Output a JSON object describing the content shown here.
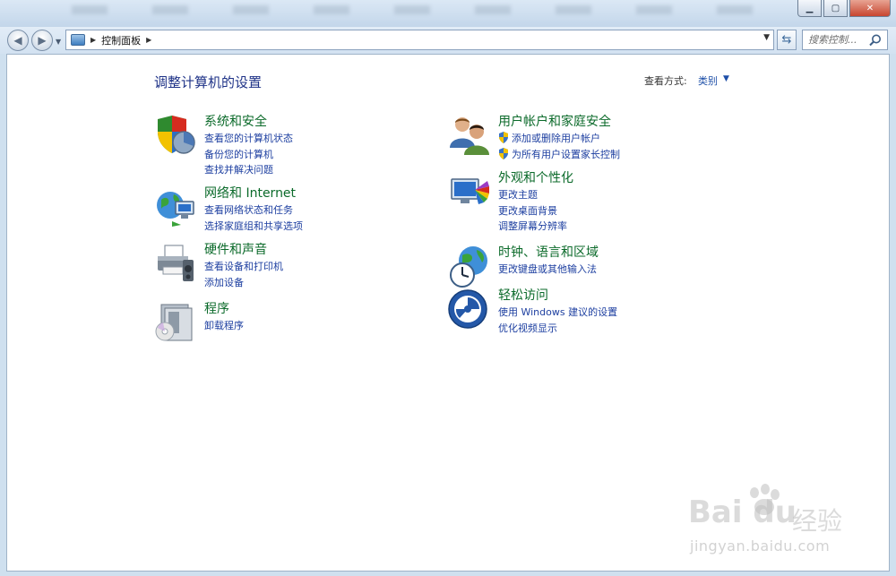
{
  "address": {
    "location": "控制面板"
  },
  "search": {
    "placeholder": "搜索控制..."
  },
  "view": {
    "label": "查看方式:",
    "value": "类别"
  },
  "page": {
    "title": "调整计算机的设置"
  },
  "categories": [
    {
      "title": "系统和安全",
      "icon": "shield-pie-icon",
      "links": [
        "查看您的计算机状态",
        "备份您的计算机",
        "查找并解决问题"
      ]
    },
    {
      "title": "网络和 Internet",
      "icon": "globe-network-icon",
      "links": [
        "查看网络状态和任务",
        "选择家庭组和共享选项"
      ]
    },
    {
      "title": "硬件和声音",
      "icon": "printer-icon",
      "links": [
        "查看设备和打印机",
        "添加设备"
      ]
    },
    {
      "title": "程序",
      "icon": "programs-icon",
      "links": [
        "卸载程序"
      ]
    },
    {
      "title": "用户帐户和家庭安全",
      "icon": "users-icon",
      "links": [
        "添加或删除用户帐户",
        "为所有用户设置家长控制"
      ]
    },
    {
      "title": "外观和个性化",
      "icon": "monitor-palette-icon",
      "links": [
        "更改主题",
        "更改桌面背景",
        "调整屏幕分辨率"
      ]
    },
    {
      "title": "时钟、语言和区域",
      "icon": "globe-clock-icon",
      "links": [
        "更改键盘或其他输入法"
      ]
    },
    {
      "title": "轻松访问",
      "icon": "ease-of-access-icon",
      "links": [
        "使用 Windows 建议的设置",
        "优化视频显示"
      ]
    }
  ],
  "watermark": {
    "brand": "Bai du",
    "sub": "经验",
    "url": "jingyan.baidu.com"
  }
}
